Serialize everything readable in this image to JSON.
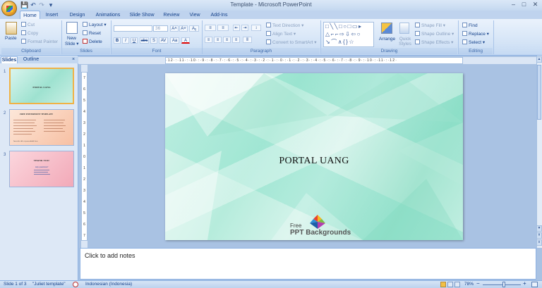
{
  "window": {
    "title": "Template - Microsoft PowerPoint",
    "minimize_glyph": "–",
    "maximize_glyph": "□",
    "close_glyph": "✕"
  },
  "quick_access": {
    "save_glyph": "💾",
    "undo_glyph": "↶",
    "redo_glyph": "↷",
    "more_glyph": "▾"
  },
  "tabs": [
    "Home",
    "Insert",
    "Design",
    "Animations",
    "Slide Show",
    "Review",
    "View",
    "Add-Ins"
  ],
  "ribbon": {
    "clipboard": {
      "label": "Clipboard",
      "paste": "Paste",
      "cut": "Cut",
      "copy": "Copy",
      "format_painter": "Format Painter"
    },
    "slides": {
      "label": "Slides",
      "new_slide_line1": "New",
      "new_slide_line2": "Slide ▾",
      "layout": "Layout ▾",
      "reset": "Reset",
      "delete": "Delete"
    },
    "font": {
      "label": "Font",
      "font_name": "",
      "font_size": "36",
      "grow": "A˄",
      "shrink": "A˅",
      "clear": "Aᵪ",
      "bold": "B",
      "italic": "I",
      "underline": "U",
      "strike": "abc",
      "shadow": "S",
      "spacing": "AV",
      "case": "Aa",
      "color": "A"
    },
    "paragraph": {
      "label": "Paragraph",
      "text_direction": "Text Direction ▾",
      "align_text": "Align Text ▾",
      "convert_smartart": "Convert to SmartArt ▾"
    },
    "drawing": {
      "label": "Drawing",
      "arrange": "Arrange",
      "quick_styles": "Quick Styles",
      "shape_fill": "Shape Fill ▾",
      "shape_outline": "Shape Outline ▾",
      "shape_effects": "Shape Effects ▾"
    },
    "editing": {
      "label": "Editing",
      "find": "Find",
      "replace": "Replace ▾",
      "select": "Select ▾"
    }
  },
  "panel": {
    "tab_slides": "Slides",
    "tab_outline": "Outline",
    "close_glyph": "×",
    "thumbnails": [
      {
        "number": "1",
        "title": "PORTAL UANG"
      },
      {
        "number": "2",
        "title": "FREE POWERPOINT TEMPLATE",
        "caption": "Insert the title of your subtitle here"
      },
      {
        "number": "3",
        "title": "THANK YOU!",
        "caption": "Any questions?"
      }
    ]
  },
  "rulers": {
    "horizontal": "·12·:·11·:·10·:·9·:·8·:·7·:·6·:·5·:·4·:·3·:·2·:·1·:·0·:·1·:·2·:·3·:·4·:·5·:·6·:·7·:·8·:·9·:·10·:·11·:·12·",
    "vertical": [
      "7",
      "6",
      "5",
      "4",
      "3",
      "2",
      "1",
      "0",
      "1",
      "2",
      "3",
      "4",
      "5",
      "6",
      "7"
    ]
  },
  "slide": {
    "title": "PORTAL UANG",
    "logo_line1": "Free",
    "logo_line2": "PPT Backgrounds"
  },
  "notes": {
    "placeholder": "Click to add notes"
  },
  "status": {
    "slide_position": "Slide 1 of 3",
    "theme": "\"Juliet template\"",
    "language": "Indonesian (Indonesia)",
    "zoom": "78%",
    "zoom_level": 0.55
  },
  "colors": {
    "ribbon": "#d3e3f6",
    "accent": "#15428b",
    "slide_bg": "#b6ecdc"
  }
}
